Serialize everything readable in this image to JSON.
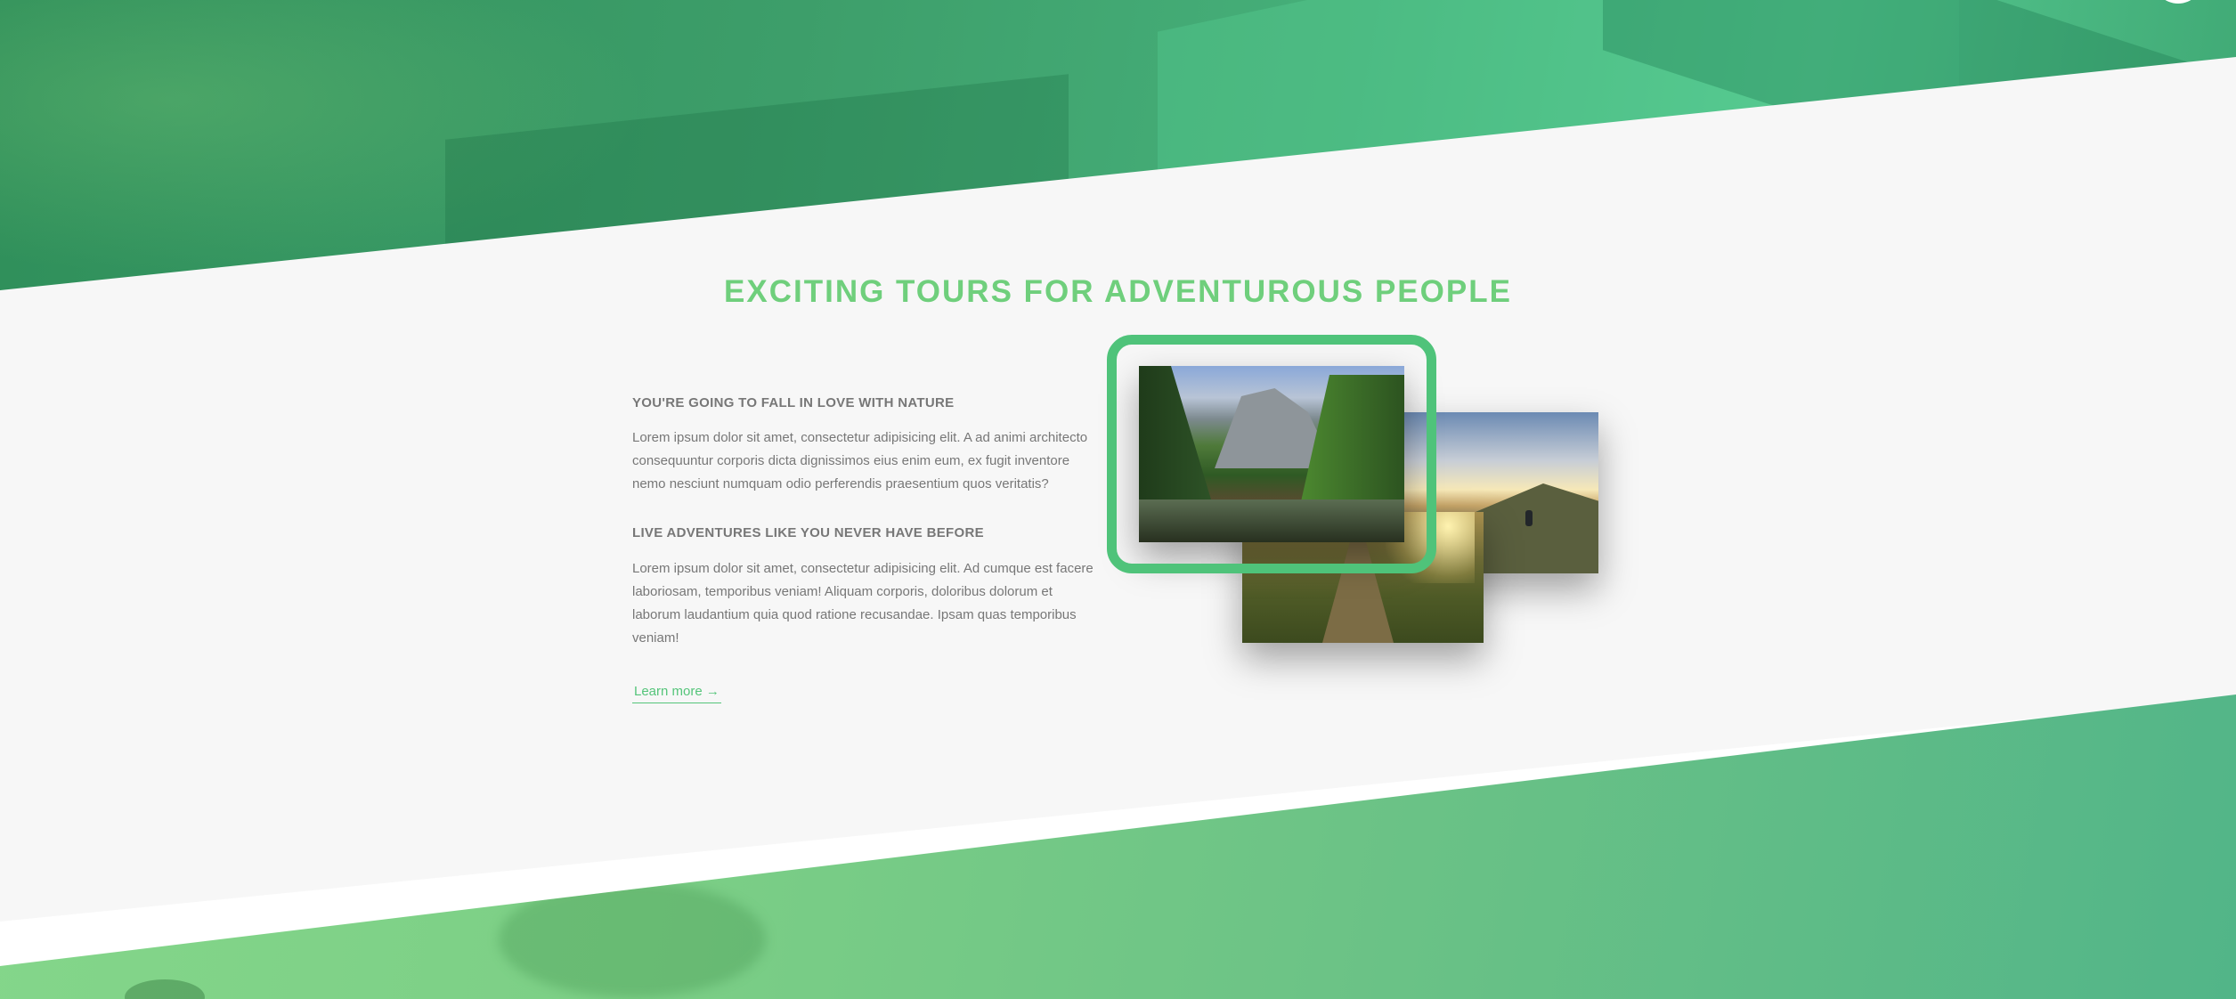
{
  "features": {
    "heading": "EXCITING TOURS FOR ADVENTUROUS PEOPLE",
    "blocks": [
      {
        "title": "YOU'RE GOING TO FALL IN LOVE WITH NATURE",
        "text": "Lorem ipsum dolor sit amet, consectetur adipisicing elit. A ad animi architecto consequuntur corporis dicta dignissimos eius enim eum, ex fugit inventore nemo nesciunt numquam odio perferendis praesentium quos veritatis?"
      },
      {
        "title": "LIVE ADVENTURES LIKE YOU NEVER HAVE BEFORE",
        "text": "Lorem ipsum dolor sit amet, consectetur adipisicing elit. Ad cumque est facere laboriosam, temporibus veniam! Aliquam corporis, doloribus dolorum et laborum laudantium quia quod ratione recusandae. Ipsam quas temporibus veniam!"
      }
    ],
    "link_label": "Learn more →"
  },
  "colors": {
    "accent": "#55c57a",
    "heading": "#6fcf7c",
    "text": "#777777",
    "section_bg": "#f7f7f7"
  },
  "photos": [
    {
      "name": "mountain-forest-lake-photo"
    },
    {
      "name": "hiker-on-hill-at-sunset-photo"
    },
    {
      "name": "grassy-path-at-sunrise-photo"
    }
  ]
}
